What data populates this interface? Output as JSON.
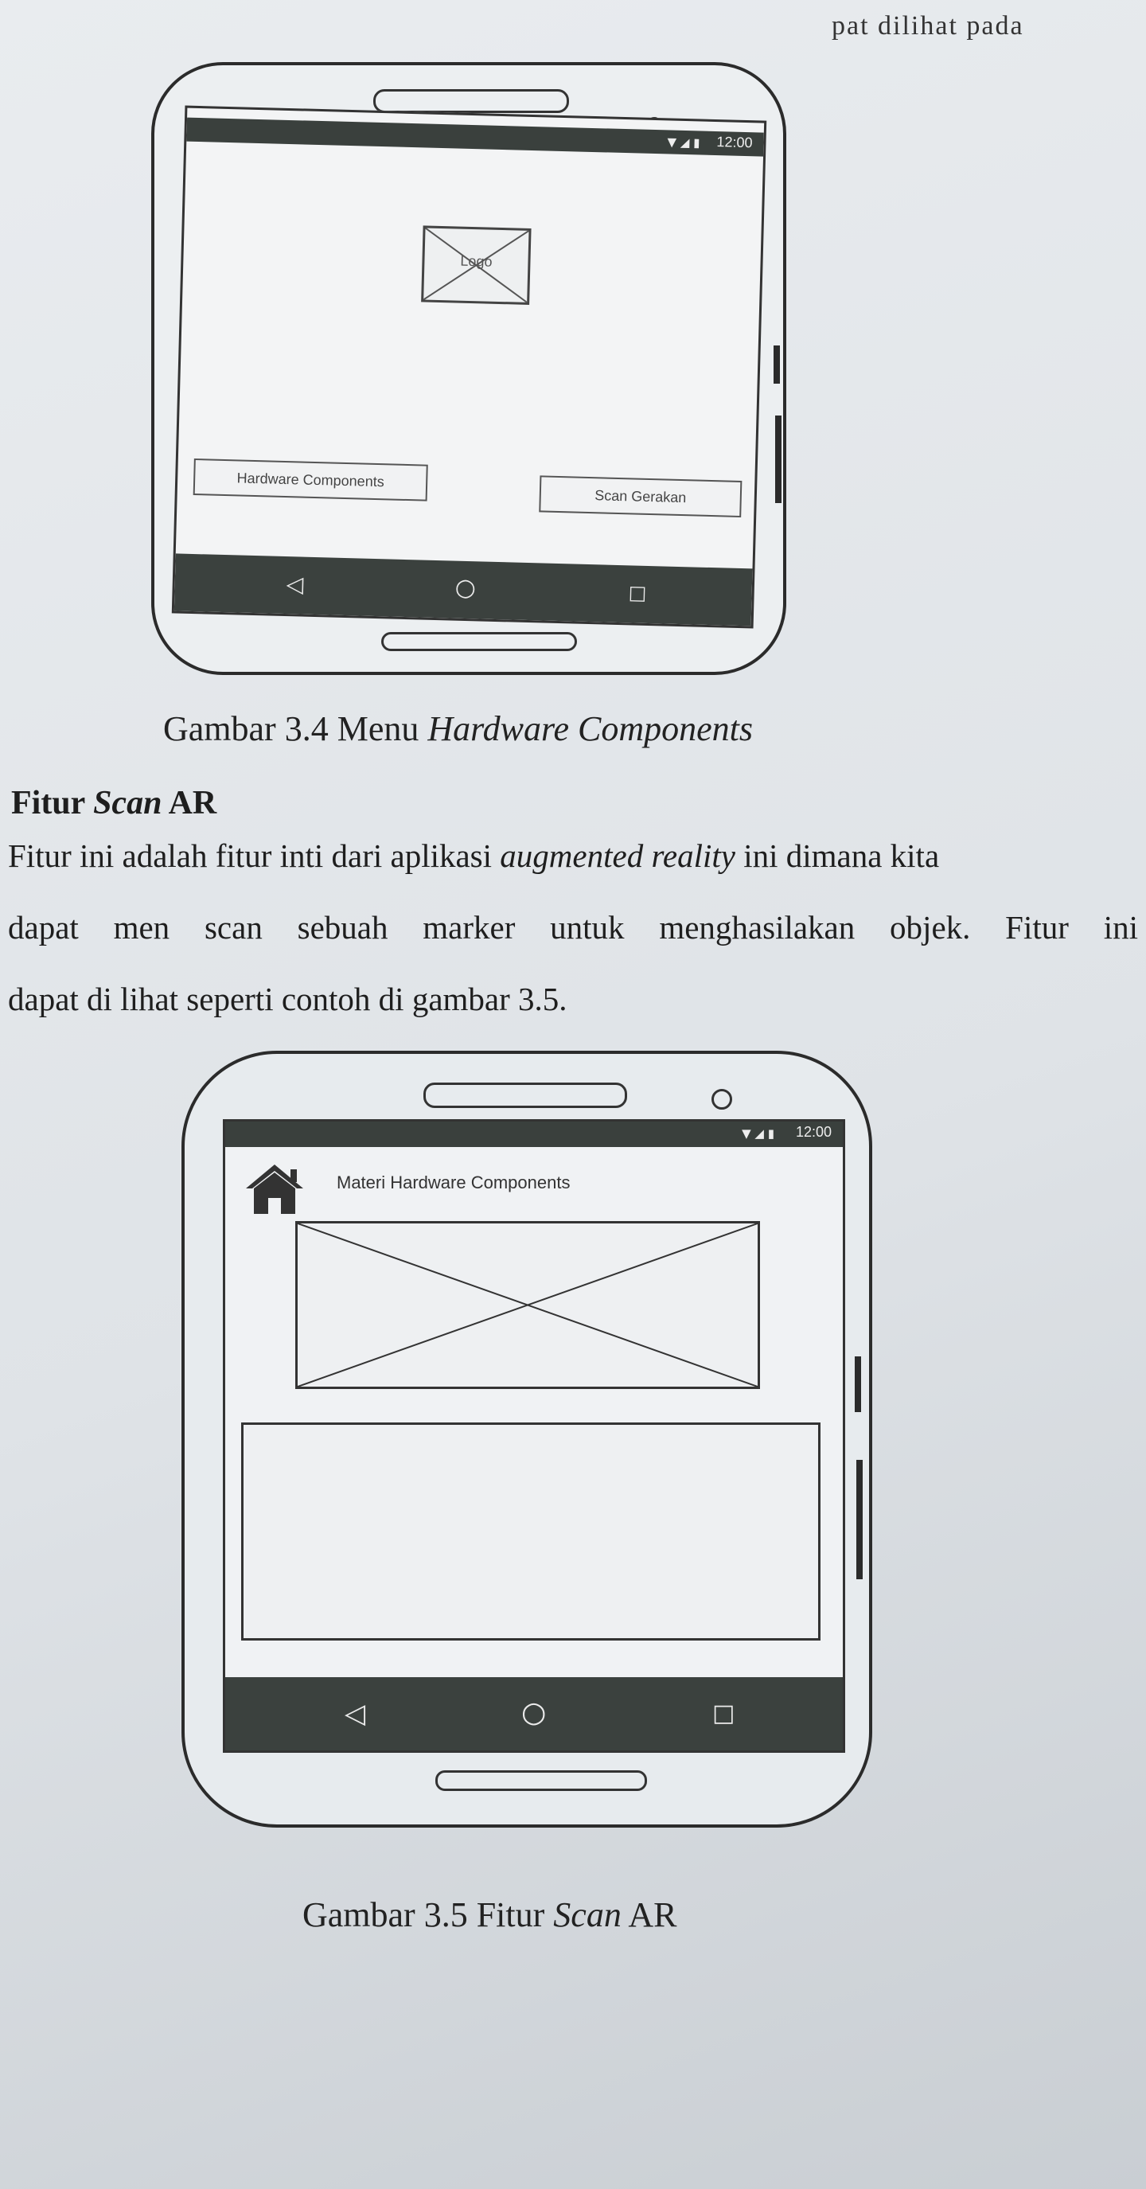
{
  "page": {
    "top_fragment": "pat dilihat  pada",
    "figure1": {
      "status_time": "12:00",
      "logo_label": "Logo",
      "button_left": "Hardware Components",
      "button_right": "Scan Gerakan",
      "caption_prefix": "Gambar 3.4 Menu ",
      "caption_italic": "Hardware Components"
    },
    "section": {
      "heading_prefix": "Fitur ",
      "heading_italic": "Scan",
      "heading_suffix": " AR",
      "line1_a": "Fitur ini adalah fitur inti dari aplikasi ",
      "line1_italic": "augmented reality",
      "line1_b": " ini dimana kita",
      "line2": "dapat men scan sebuah marker untuk menghasilakan objek. Fitur ini",
      "line3": "dapat di lihat seperti contoh di gambar 3.5."
    },
    "figure2": {
      "status_time": "12:00",
      "screen_title": "Materi Hardware Components",
      "caption_prefix": "Gambar 3.5 Fitur ",
      "caption_italic": "Scan",
      "caption_suffix": " AR"
    }
  },
  "icons": {
    "status": [
      "wifi-icon",
      "signal-icon",
      "battery-icon"
    ],
    "nav": [
      "back-icon",
      "home-circle-icon",
      "recents-icon"
    ],
    "header": "house-icon"
  },
  "colors": {
    "bar": "#3a403d",
    "page": "#e6e9ec"
  }
}
